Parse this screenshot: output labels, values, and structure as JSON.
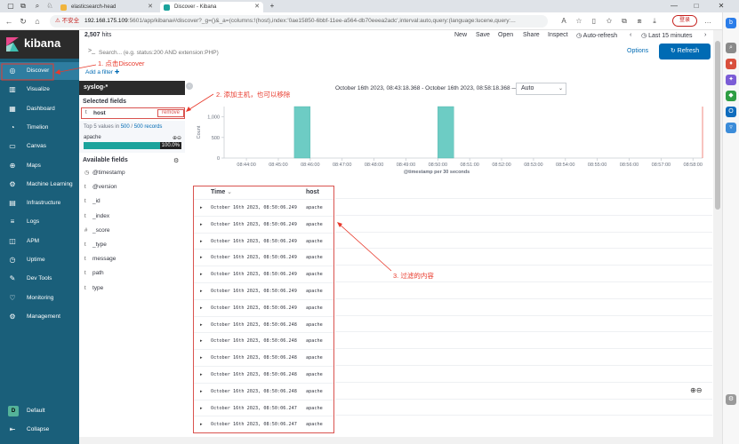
{
  "browser": {
    "tabs": [
      {
        "label": "elasticsearch-head",
        "favicon_color": "#f0b43c"
      },
      {
        "label": "Discover - Kibana",
        "favicon_color": "#1ba39c"
      }
    ],
    "new_tab": "+",
    "window_controls": [
      "—",
      "□",
      "✕"
    ],
    "address": {
      "warning": "⚠ 不安全",
      "host": "192.168.175.109",
      "path": ":5601/app/kibana#/discover?_g=()&_a=(columns:!(host),index:'0ae15850-6bbf-11ee-a564-db70eeea2adc',interval:auto,query:(language:lucene,query:..."
    },
    "login_label": "登录"
  },
  "kibana": {
    "brand": "kibana",
    "nav": [
      {
        "label": "Discover",
        "icon": "compass-icon",
        "glyph": "◎"
      },
      {
        "label": "Visualize",
        "icon": "visualize-icon",
        "glyph": "▥"
      },
      {
        "label": "Dashboard",
        "icon": "dashboard-icon",
        "glyph": "▦"
      },
      {
        "label": "Timelion",
        "icon": "timelion-icon",
        "glyph": "◔"
      },
      {
        "label": "Canvas",
        "icon": "canvas-icon",
        "glyph": "▭"
      },
      {
        "label": "Maps",
        "icon": "maps-icon",
        "glyph": "⊕"
      },
      {
        "label": "Machine Learning",
        "icon": "ml-icon",
        "glyph": "⚙"
      },
      {
        "label": "Infrastructure",
        "icon": "infrastructure-icon",
        "glyph": "▤"
      },
      {
        "label": "Logs",
        "icon": "logs-icon",
        "glyph": "≡"
      },
      {
        "label": "APM",
        "icon": "apm-icon",
        "glyph": "◫"
      },
      {
        "label": "Uptime",
        "icon": "uptime-icon",
        "glyph": "◷"
      },
      {
        "label": "Dev Tools",
        "icon": "wrench-icon",
        "glyph": "✎"
      },
      {
        "label": "Monitoring",
        "icon": "heartbeat-icon",
        "glyph": "♡"
      },
      {
        "label": "Management",
        "icon": "gear-icon",
        "glyph": "⚙"
      }
    ],
    "space_badge": "D",
    "space_label": "Default",
    "collapse_label": "Collapse",
    "hits": "2,507",
    "hits_suffix": "hits",
    "top_menu": [
      "New",
      "Save",
      "Open",
      "Share",
      "Inspect"
    ],
    "auto_refresh": "Auto-refresh",
    "time_range": "Last 15 minutes",
    "query_prefix": ">_",
    "query_placeholder": "Search... (e.g. status:200 AND extension:PHP)",
    "options_label": "Options",
    "refresh_label": "Refresh",
    "add_filter": "Add a filter",
    "index_pattern": "syslog-*",
    "selected_fields_title": "Selected fields",
    "selected_field": {
      "type": "t",
      "name": "host",
      "remove": "remove"
    },
    "field_detail": {
      "top_prefix": "Top 5 values in ",
      "top_count": "500",
      "top_mid": " / ",
      "top_total": "500 records",
      "value": "apache",
      "percent": "100.0%",
      "fraction": 1.0
    },
    "available_fields_title": "Available fields",
    "available_fields": [
      {
        "type": "◷",
        "name": "@timestamp"
      },
      {
        "type": "t",
        "name": "@version"
      },
      {
        "type": "t",
        "name": "_id"
      },
      {
        "type": "t",
        "name": "_index"
      },
      {
        "type": "#",
        "name": "_score"
      },
      {
        "type": "t",
        "name": "_type"
      },
      {
        "type": "t",
        "name": "message"
      },
      {
        "type": "t",
        "name": "path"
      },
      {
        "type": "t",
        "name": "type"
      }
    ],
    "histogram_range": "October 16th 2023, 08:43:18.368 - October 16th 2023, 08:58:18.368 —",
    "interval": "Auto",
    "table": {
      "col_time": "Time",
      "col_host": "host",
      "rows": [
        {
          "time": "October 16th 2023, 08:50:06.249",
          "host": "apache"
        },
        {
          "time": "October 16th 2023, 08:50:06.249",
          "host": "apache"
        },
        {
          "time": "October 16th 2023, 08:50:06.249",
          "host": "apache"
        },
        {
          "time": "October 16th 2023, 08:50:06.249",
          "host": "apache"
        },
        {
          "time": "October 16th 2023, 08:50:06.249",
          "host": "apache"
        },
        {
          "time": "October 16th 2023, 08:50:06.249",
          "host": "apache"
        },
        {
          "time": "October 16th 2023, 08:50:06.249",
          "host": "apache"
        },
        {
          "time": "October 16th 2023, 08:50:06.248",
          "host": "apache"
        },
        {
          "time": "October 16th 2023, 08:50:06.248",
          "host": "apache"
        },
        {
          "time": "October 16th 2023, 08:50:06.248",
          "host": "apache"
        },
        {
          "time": "October 16th 2023, 08:50:06.248",
          "host": "apache"
        },
        {
          "time": "October 16th 2023, 08:50:06.248",
          "host": "apache"
        },
        {
          "time": "October 16th 2023, 08:50:06.247",
          "host": "apache"
        },
        {
          "time": "October 16th 2023, 08:50:06.247",
          "host": "apache"
        }
      ]
    }
  },
  "annotations": {
    "a1": "1. 点击Discover",
    "a2": "2. 添加主机，也可以移除",
    "a3": "3. 过滤的内容",
    "color": "#e8392b"
  },
  "chart_data": {
    "type": "bar",
    "xlabel": "@timestamp per 30 seconds",
    "ylabel": "Count",
    "yticks": [
      0,
      500,
      1000
    ],
    "ytick_labels": [
      "0",
      "500",
      "1,000"
    ],
    "ylim": [
      0,
      1250
    ],
    "x_tick_labels": [
      "08:44:00",
      "08:45:00",
      "08:46:00",
      "08:47:00",
      "08:48:00",
      "08:49:00",
      "08:50:00",
      "08:51:00",
      "08:52:00",
      "08:53:00",
      "08:54:00",
      "08:55:00",
      "08:56:00",
      "08:57:00",
      "08:58:00"
    ],
    "bars": [
      {
        "x": "08:45:30",
        "value": 1250
      },
      {
        "x": "08:50:00",
        "value": 1250
      }
    ],
    "bar_color": "#6dccc4",
    "xrange": [
      "08:43:18",
      "08:58:18"
    ]
  }
}
